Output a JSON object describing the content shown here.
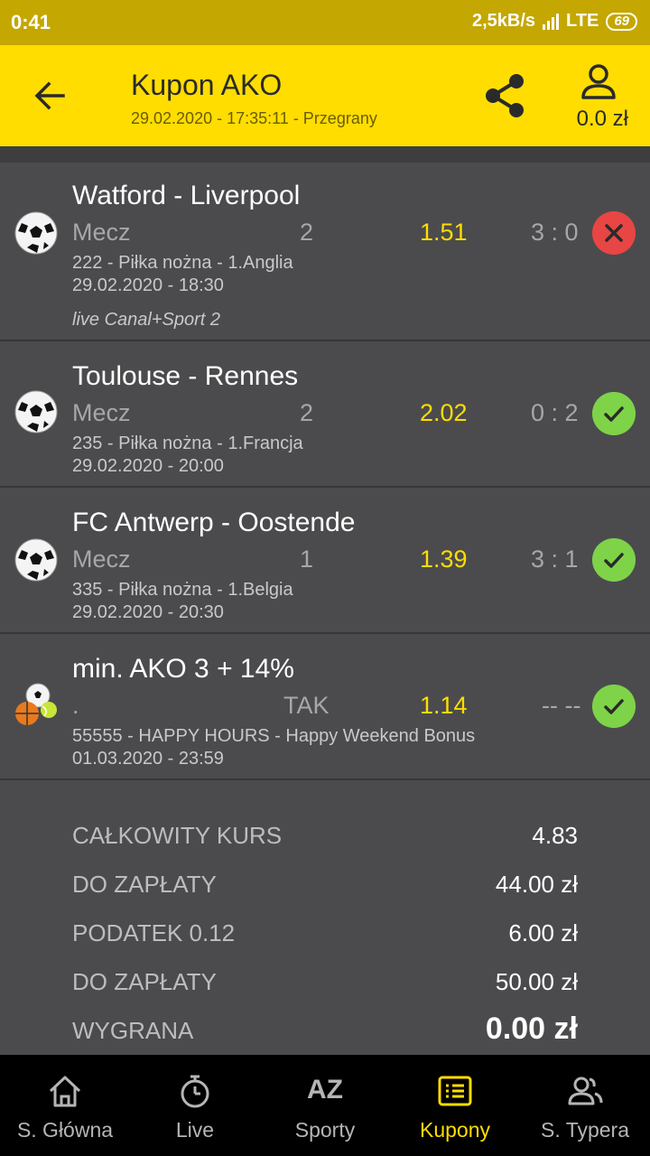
{
  "status_bar": {
    "time": "0:41",
    "network_speed": "2,5kB/s",
    "network_type": "LTE",
    "battery": "69"
  },
  "header": {
    "title": "Kupon AKO",
    "subtitle": "29.02.2020 - 17:35:11 - Przegrany",
    "balance": "0.0 zł"
  },
  "bets": [
    {
      "match": "Watford - Liverpool",
      "market": "Mecz",
      "pick": "2",
      "odds": "1.51",
      "score": "3 : 0",
      "result": "lost",
      "info": "222 - Piłka nożna - 1.Anglia",
      "date": "29.02.2020 - 18:30",
      "tv": "live Canal+Sport 2"
    },
    {
      "match": "Toulouse - Rennes",
      "market": "Mecz",
      "pick": "2",
      "odds": "2.02",
      "score": "0 : 2",
      "result": "won",
      "info": "235 - Piłka nożna - 1.Francja",
      "date": "29.02.2020 - 20:00"
    },
    {
      "match": "FC Antwerp - Oostende",
      "market": "Mecz",
      "pick": "1",
      "odds": "1.39",
      "score": "3 : 1",
      "result": "won",
      "info": "335 - Piłka nożna - 1.Belgia",
      "date": "29.02.2020 - 20:30"
    },
    {
      "match": "min. AKO 3 + 14%",
      "market": ".",
      "pick": "TAK",
      "odds": "1.14",
      "score": "-- --",
      "result": "won",
      "info": "55555 - HAPPY HOURS - Happy Weekend Bonus",
      "date": "01.03.2020 - 23:59"
    }
  ],
  "totals": [
    {
      "label": "CAŁKOWITY KURS",
      "value": "4.83"
    },
    {
      "label": "DO ZAPŁATY",
      "value": "44.00 zł"
    },
    {
      "label": "PODATEK 0.12",
      "value": "6.00 zł"
    },
    {
      "label": "DO ZAPŁATY",
      "value": "50.00 zł"
    },
    {
      "label": "WYGRANA",
      "value": "0.00 zł"
    }
  ],
  "nav": {
    "home": "S. Główna",
    "live": "Live",
    "sports_icon": "AZ",
    "sports": "Sporty",
    "coupons": "Kupony",
    "tipster": "S. Typera"
  },
  "colors": {
    "accent": "#ffdd00",
    "background": "#4b4b4d",
    "lost": "#e84545",
    "won": "#7ed348"
  }
}
